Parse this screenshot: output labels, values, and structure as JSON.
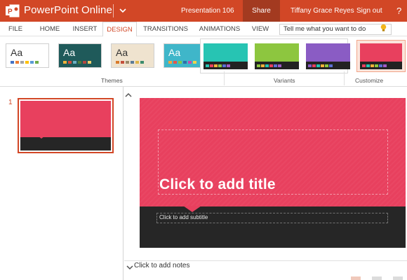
{
  "titlebar": {
    "app_name": "PowerPoint Online",
    "doc_name": "Presentation 106",
    "share_label": "Share",
    "user_name": "Tiffany Grace Reyes",
    "signout_label": "Sign out",
    "help_label": "?"
  },
  "tabs": [
    {
      "label": "FILE"
    },
    {
      "label": "HOME"
    },
    {
      "label": "INSERT"
    },
    {
      "label": "DESIGN",
      "active": true
    },
    {
      "label": "TRANSITIONS"
    },
    {
      "label": "ANIMATIONS"
    },
    {
      "label": "VIEW"
    }
  ],
  "tell_me": {
    "text": "Tell me what you want to do"
  },
  "ribbon": {
    "themes_label": "Themes",
    "variants_label": "Variants",
    "customize_label": "Customize",
    "themes": [
      {
        "aa": "Aa",
        "bg": "#ffffff",
        "text_color": "#333333",
        "swatches": [
          "#4472c4",
          "#ed7d31",
          "#a5a5a5",
          "#ffc000",
          "#5b9bd5",
          "#70ad47"
        ]
      },
      {
        "aa": "Aa",
        "bg": "#1f5a5a",
        "text_color": "#ffffff",
        "swatches": [
          "#f0b23a",
          "#d14a3a",
          "#6bb0c4",
          "#4c7c3a",
          "#b6483f",
          "#f3d16b"
        ]
      },
      {
        "aa": "Aa",
        "bg": "#efe3cf",
        "text_color": "#333333",
        "swatches": [
          "#d97b2b",
          "#c44f3a",
          "#9a8a6a",
          "#5c7c98",
          "#e0b54a",
          "#3c8c6c"
        ]
      },
      {
        "aa": "Aa",
        "bg": "#3fb6c9",
        "text_color": "#ffffff",
        "swatches": [
          "#f4a53a",
          "#e7564a",
          "#7fc94a",
          "#2f6fa8",
          "#c44ab0",
          "#f0d44a"
        ]
      }
    ],
    "variants": [
      {
        "bg": "#27c4b3",
        "swatches": [
          "#27c4b3",
          "#e8405e",
          "#f2b13a",
          "#8bc34a",
          "#5b6fd4",
          "#a05cc7"
        ]
      },
      {
        "bg": "#8dc63f",
        "swatches": [
          "#8dc63f",
          "#f2b13a",
          "#27c4b3",
          "#e8405e",
          "#5b6fd4",
          "#a05cc7"
        ]
      },
      {
        "bg": "#8a5cc4",
        "swatches": [
          "#8a5cc4",
          "#e8405e",
          "#27c4b3",
          "#f2b13a",
          "#8dc63f",
          "#5b6fd4"
        ]
      },
      {
        "bg": "#e8405e",
        "swatches": [
          "#e8405e",
          "#27c4b3",
          "#f2b13a",
          "#8dc63f",
          "#5b6fd4",
          "#a05cc7"
        ]
      }
    ]
  },
  "slides": [
    {
      "number": "1",
      "accent": "#e8405e",
      "dark": "#262626"
    }
  ],
  "slide": {
    "title_placeholder": "Click to add title",
    "subtitle_placeholder": "Click to add subtitle"
  },
  "notes": {
    "placeholder": "Click to add notes"
  },
  "colors": {
    "brand": "#d24726",
    "share_bg": "#a33a20",
    "slide_accent": "#e8405e",
    "slide_dark": "#262626"
  },
  "icons": {
    "logo": "powerpoint-logo-icon",
    "title_chevron": "chevron-down-icon",
    "tell_me": "lightbulb-icon",
    "scroll_up": "chevron-up-icon",
    "notes_toggle": "chevron-down-icon"
  }
}
